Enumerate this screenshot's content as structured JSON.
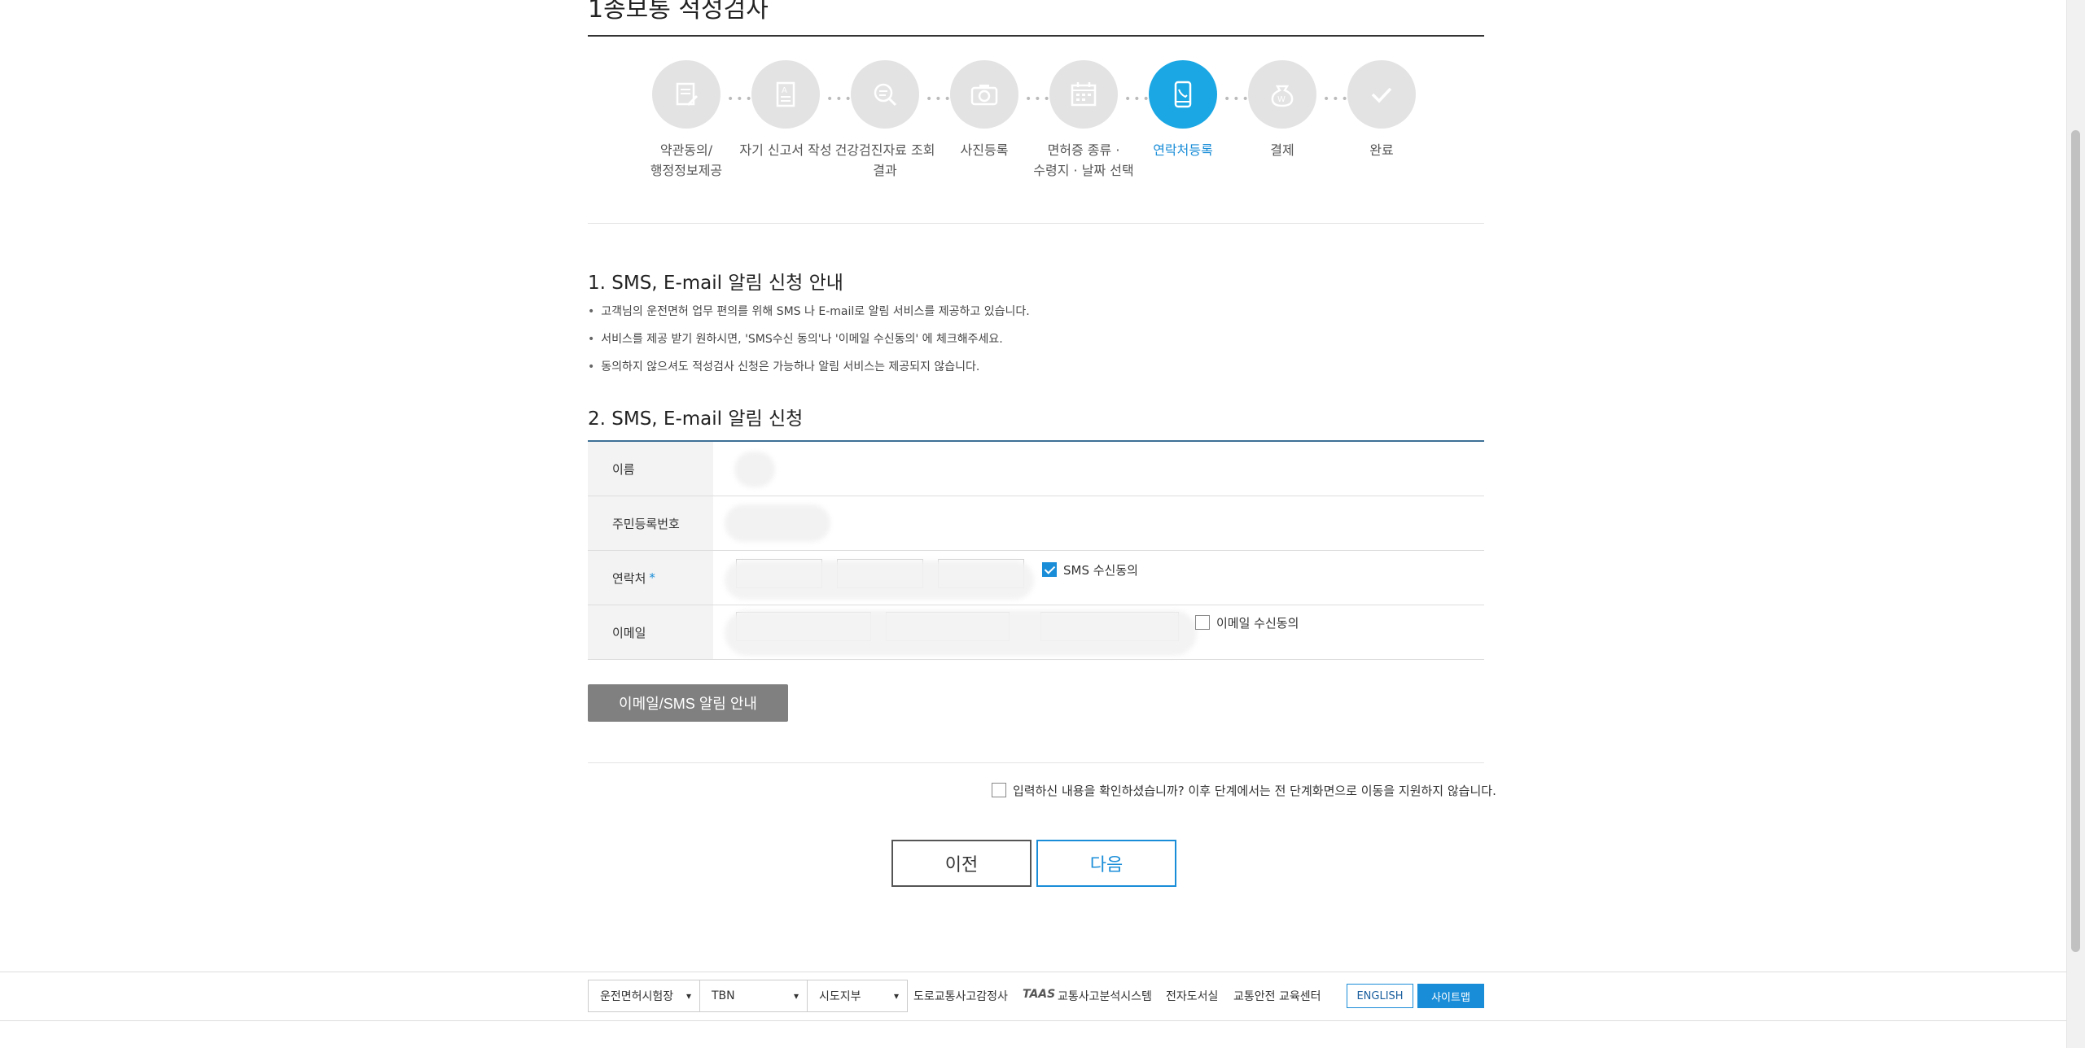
{
  "page": {
    "title": "1종보통 적성검사"
  },
  "steps": [
    {
      "label": "약관동의/\n행정정보제공",
      "icon": "document-edit-icon",
      "active": false
    },
    {
      "label": "자기 신고서 작성",
      "icon": "form-icon",
      "active": false
    },
    {
      "label": "건강검진자료 조회\n결과",
      "icon": "search-document-icon",
      "active": false
    },
    {
      "label": "사진등록",
      "icon": "camera-icon",
      "active": false
    },
    {
      "label": "면허증 종류 ·\n수령지 · 날짜 선택",
      "icon": "calendar-icon",
      "active": false
    },
    {
      "label": "연락처등록",
      "icon": "phone-icon",
      "active": true
    },
    {
      "label": "결제",
      "icon": "payment-icon",
      "active": false
    },
    {
      "label": "완료",
      "icon": "check-icon",
      "active": false
    }
  ],
  "section1": {
    "title": "1. SMS, E-mail 알림 신청 안내",
    "bullets": [
      "고객님의 운전면허 업무 편의를 위해 SMS 나 E-mail로 알림 서비스를 제공하고 있습니다.",
      "서비스를 제공 받기 원하시면, 'SMS수신 동의'나 '이메일 수신동의' 에 체크해주세요.",
      "동의하지 않으셔도 적성검사 신청은 가능하나 알림 서비스는 제공되지 않습니다."
    ]
  },
  "section2": {
    "title": "2. SMS, E-mail 알림 신청",
    "rows": {
      "name": "이름",
      "rrn": "주민등록번호",
      "phone": "연락처",
      "phone_required": "*",
      "email": "이메일"
    },
    "sms_consent_label": "SMS 수신동의",
    "sms_consent_checked": true,
    "email_consent_label": "이메일 수신동의",
    "email_consent_checked": false,
    "guide_button": "이메일/SMS 알림 안내"
  },
  "confirm": {
    "label": "입력하신 내용을 확인하셨습니까? 이후 단계에서는 전 단계화면으로 이동을 지원하지 않습니다.",
    "checked": false
  },
  "nav": {
    "prev": "이전",
    "next": "다음"
  },
  "footer": {
    "selects": [
      "운전면허시험장",
      "TBN",
      "시도지부"
    ],
    "links": [
      "도로교통사고감정사",
      "교통사고분석시스템",
      "전자도서실",
      "교통안전 교육센터"
    ],
    "taas_logo": "TAAS",
    "english": "ENGLISH",
    "sitemap": "사이트맵"
  },
  "colors": {
    "accent": "#1a8dd8",
    "active_step": "#1aa7e4",
    "table_border": "#3d6f96"
  }
}
